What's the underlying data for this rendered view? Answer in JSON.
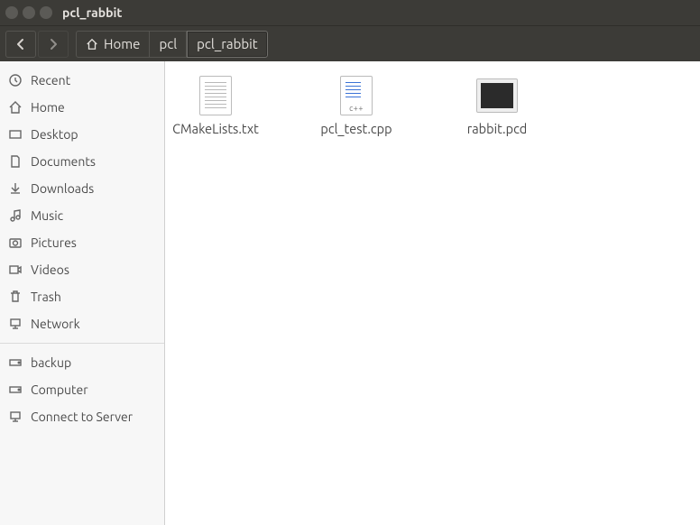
{
  "window": {
    "title": "pcl_rabbit"
  },
  "breadcrumb": {
    "home_label": "Home",
    "seg1": "pcl",
    "seg2": "pcl_rabbit"
  },
  "sidebar": {
    "items": [
      {
        "label": "Recent"
      },
      {
        "label": "Home"
      },
      {
        "label": "Desktop"
      },
      {
        "label": "Documents"
      },
      {
        "label": "Downloads"
      },
      {
        "label": "Music"
      },
      {
        "label": "Pictures"
      },
      {
        "label": "Videos"
      },
      {
        "label": "Trash"
      },
      {
        "label": "Network"
      }
    ],
    "items2": [
      {
        "label": "backup"
      },
      {
        "label": "Computer"
      },
      {
        "label": "Connect to Server"
      }
    ]
  },
  "files": [
    {
      "name": "CMakeLists.txt",
      "kind": "text"
    },
    {
      "name": "pcl_test.cpp",
      "kind": "cpp"
    },
    {
      "name": "rabbit.pcd",
      "kind": "pcd"
    }
  ]
}
